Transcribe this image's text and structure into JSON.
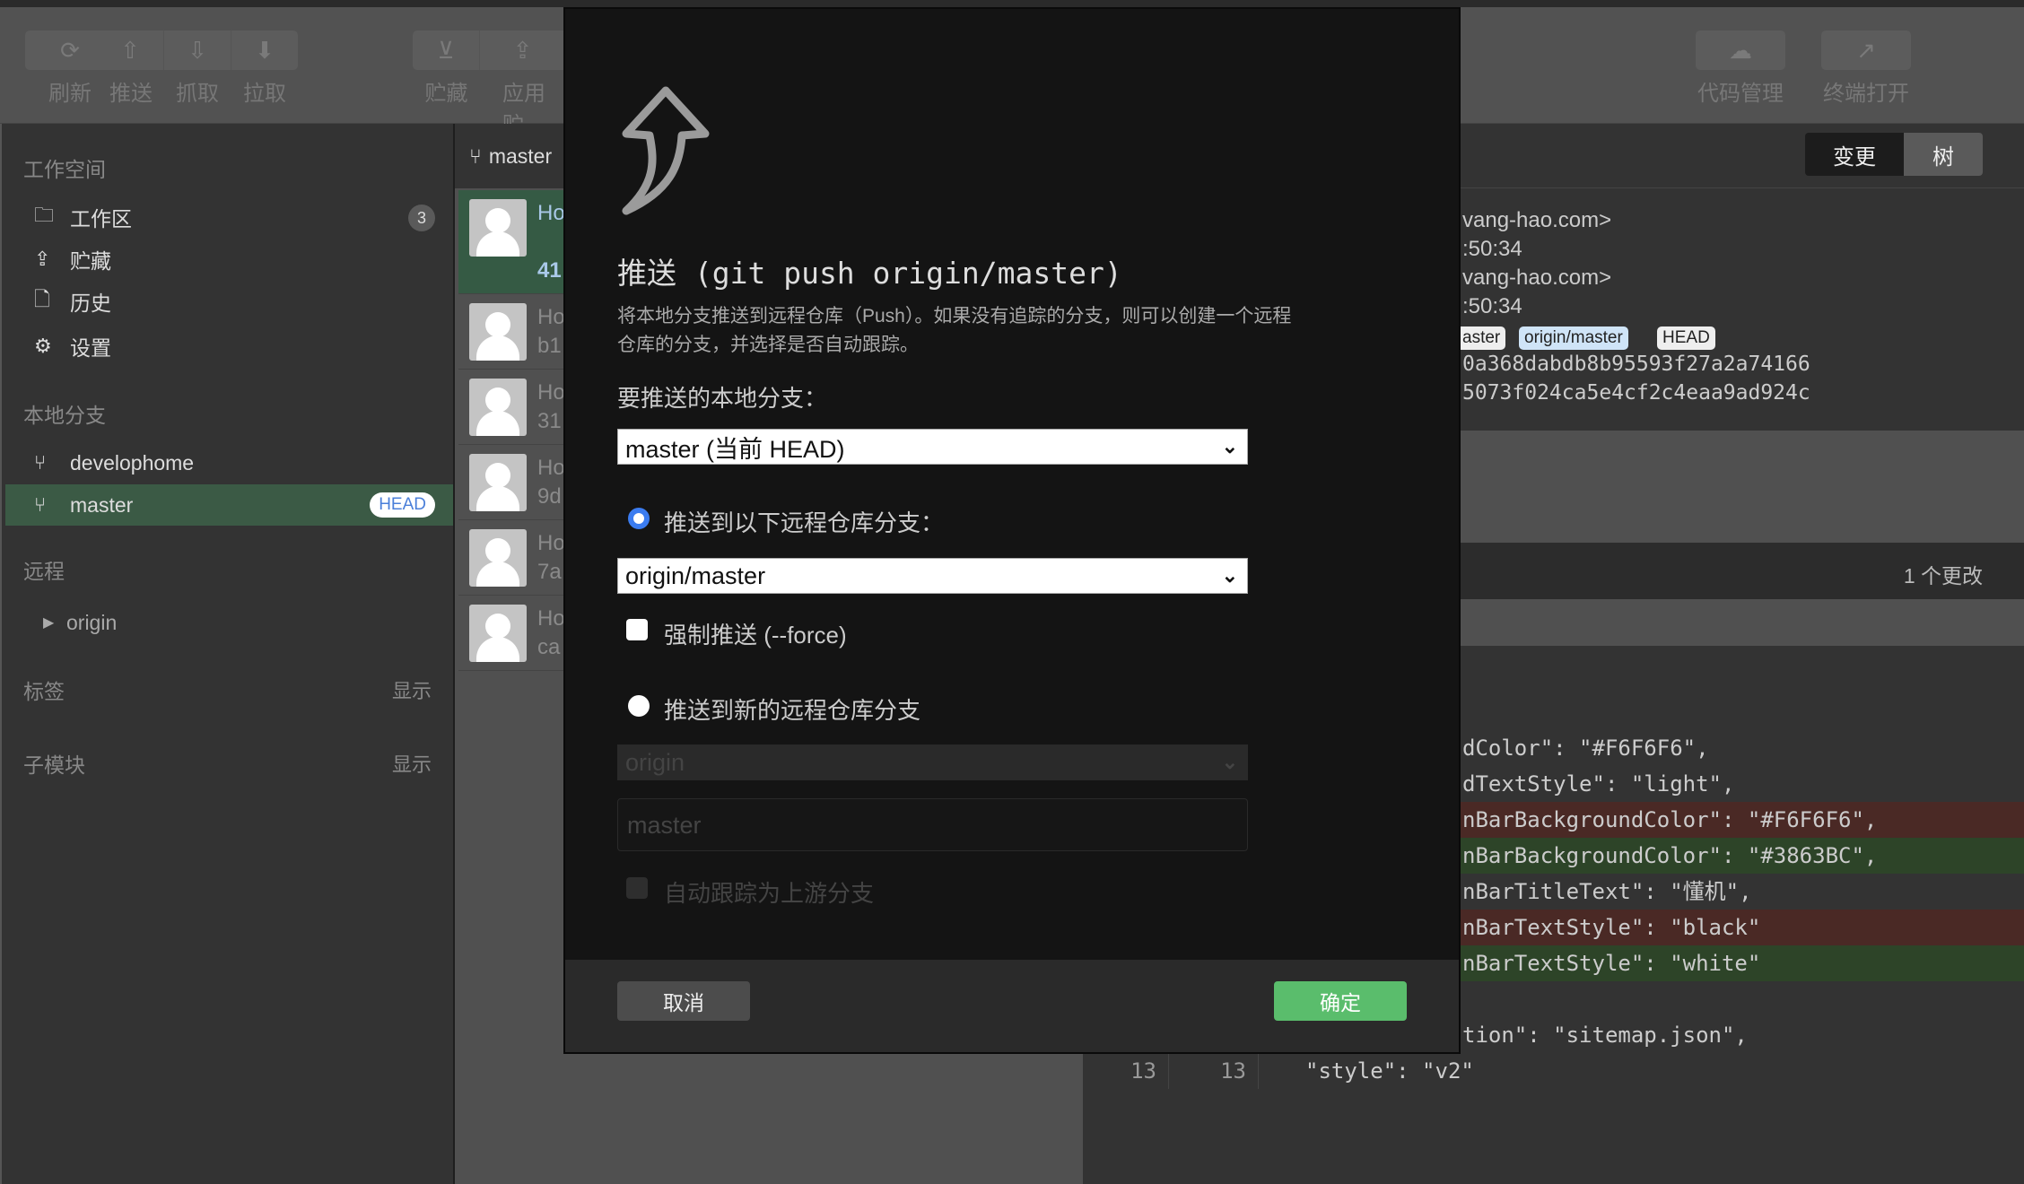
{
  "toolbar": {
    "buttons": [
      {
        "label": "刷新",
        "icon": "refresh-icon"
      },
      {
        "label": "推送",
        "icon": "push-icon"
      },
      {
        "label": "抓取",
        "icon": "fetch-icon"
      },
      {
        "label": "拉取",
        "icon": "pull-icon"
      },
      {
        "label": "贮藏",
        "icon": "stash-icon"
      },
      {
        "label": "应用贮",
        "icon": "apply-stash-icon"
      },
      {
        "label": "代码管理",
        "icon": "cloud-icon"
      },
      {
        "label": "终端打开",
        "icon": "terminal-open-icon"
      }
    ]
  },
  "sidebar": {
    "workspace_title": "工作空间",
    "workspace_items": [
      {
        "label": "工作区",
        "badge": "3",
        "icon": "folder-icon"
      },
      {
        "label": "贮藏",
        "icon": "stash-icon"
      },
      {
        "label": "历史",
        "icon": "history-icon"
      },
      {
        "label": "设置",
        "icon": "gear-icon"
      }
    ],
    "local_title": "本地分支",
    "branches": [
      {
        "label": "develophome"
      },
      {
        "label": "master",
        "badge": "HEAD"
      }
    ],
    "remote_title": "远程",
    "remotes": [
      {
        "label": "origin"
      }
    ],
    "tags_title": "标签",
    "tags_action": "显示",
    "submodules_title": "子模块",
    "submodules_action": "显示"
  },
  "commits": {
    "branch": "master",
    "items": [
      {
        "title": "Ho",
        "hash": "41"
      },
      {
        "title": "Ho",
        "hash": "b1"
      },
      {
        "title": "Ho",
        "hash": "31"
      },
      {
        "title": "Ho",
        "hash": "9d"
      },
      {
        "title": "Ho",
        "hash": "7a"
      },
      {
        "title": "Ho",
        "hash": "ca"
      }
    ]
  },
  "detail": {
    "tabs": [
      "变更",
      "树"
    ],
    "lines": [
      "vang-hao.com>",
      ":50:34",
      "vang-hao.com>",
      ":50:34"
    ],
    "refs": [
      "aster",
      "origin/master",
      "HEAD"
    ],
    "hashes": [
      "0a368dabdb8b95593f27a2a74166",
      "5073f024ca5e4cf2c4eaa9ad924c"
    ],
    "changes": "1 个更改"
  },
  "diff": {
    "lines": [
      {
        "type": "ctx",
        "text": "dColor\": \"#F6F6F6\","
      },
      {
        "type": "ctx",
        "text": "dTextStyle\": \"light\","
      },
      {
        "type": "del",
        "text": "nBarBackgroundColor\": \"#F6F6F6\","
      },
      {
        "type": "add",
        "text": "nBarBackgroundColor\": \"#3863BC\","
      },
      {
        "type": "ctx",
        "text": "nBarTitleText\": \"懂机\","
      },
      {
        "type": "del",
        "text": "nBarTextStyle\": \"black\""
      },
      {
        "type": "add",
        "text": "nBarTextStyle\": \"white\""
      },
      {
        "type": "ctx",
        "text": ""
      },
      {
        "type": "ctx",
        "text": "tion\": \"sitemap.json\","
      }
    ],
    "last": {
      "old": "13",
      "new": "13",
      "text": "\"style\": \"v2\""
    }
  },
  "dialog": {
    "icon": "push-arrow-icon",
    "title": "推送 (git push origin/master)",
    "description_1": "将本地分支推送到远程仓库（Push）。如果没有追踪的分支，则可以创建一个远程",
    "description_2": "仓库的分支，并选择是否自动跟踪。",
    "local_label": "要推送的本地分支：",
    "local_value": "master (当前 HEAD)",
    "option_existing": "推送到以下远程仓库分支：",
    "remote_branch_value": "origin/master",
    "force_label": "强制推送 (--force)",
    "option_new": "推送到新的远程仓库分支",
    "new_remote_value": "origin",
    "new_branch_placeholder": "master",
    "track_label": "自动跟踪为上游分支",
    "cancel": "取消",
    "ok": "确定",
    "accent": "#5abd6c"
  }
}
